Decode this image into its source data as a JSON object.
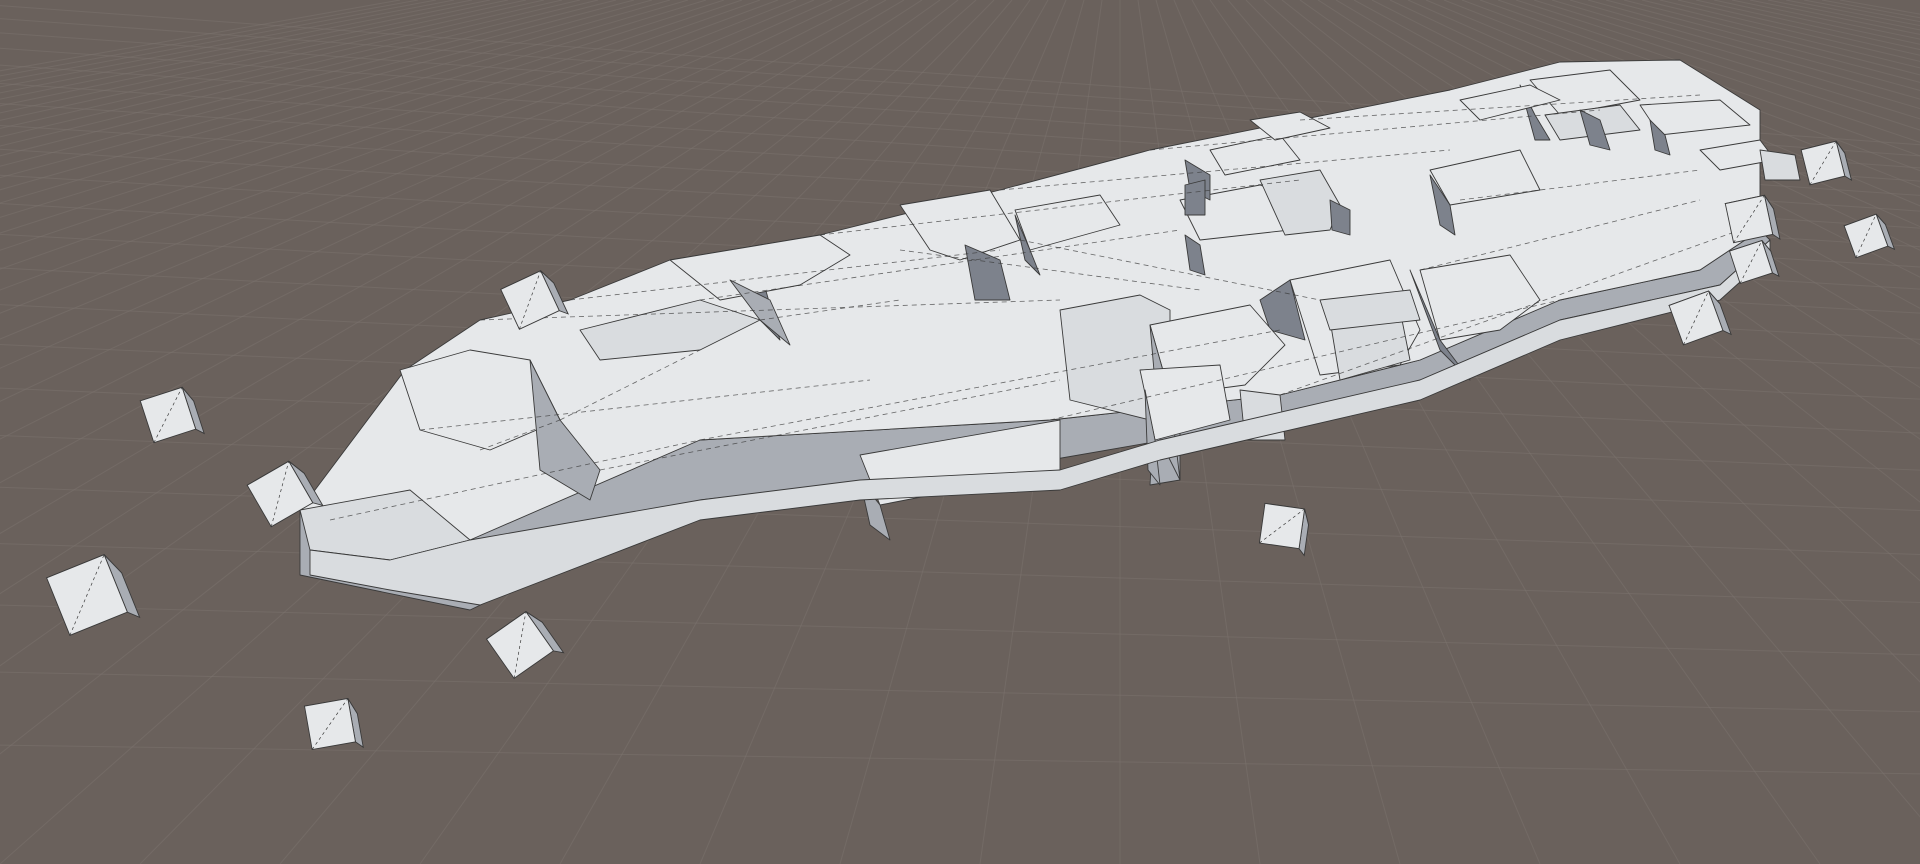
{
  "scene": {
    "background_color": "#6a615c",
    "grid_line_color": "#7b736e",
    "fragment_top_color": "#e6e8ea",
    "fragment_light_color": "#d9dcdf",
    "fragment_shadow_color": "#a9adb4",
    "fragment_dark_color": "#7d828c",
    "edge_color": "#3a3a3a",
    "wireframe_overlay": true,
    "grid_visible": true
  }
}
